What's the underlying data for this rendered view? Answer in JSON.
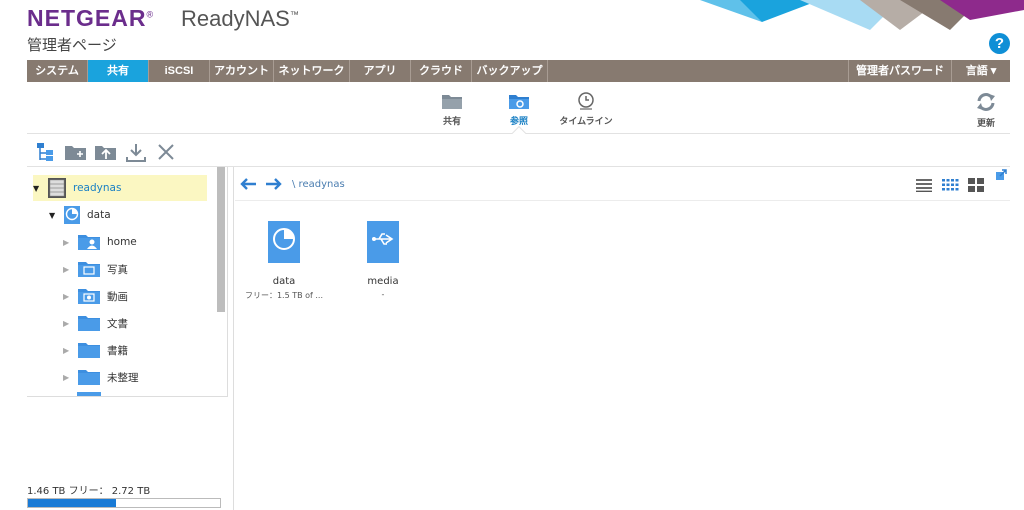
{
  "header": {
    "brand": "NETGEAR",
    "brand_mark": "®",
    "product": "ReadyNAS",
    "product_mark": "™",
    "subtitle": "管理者ページ",
    "help": "?"
  },
  "nav": {
    "tabs": [
      {
        "label": "システム",
        "active": false
      },
      {
        "label": "共有",
        "active": true
      },
      {
        "label": "iSCSI",
        "active": false
      },
      {
        "label": "アカウント",
        "active": false
      },
      {
        "label": "ネットワーク",
        "active": false
      },
      {
        "label": "アプリ",
        "active": false
      },
      {
        "label": "クラウド",
        "active": false
      },
      {
        "label": "バックアップ",
        "active": false
      }
    ],
    "admin_password": "管理者パスワード",
    "language": "言語 ▾"
  },
  "subnav": {
    "shares": "共有",
    "browse": "参照",
    "timeline": "タイムライン",
    "refresh": "更新"
  },
  "tree": {
    "root": "readynas",
    "volume": "data",
    "folders": [
      "home",
      "写真",
      "動画",
      "文書",
      "書籍",
      "未整理"
    ]
  },
  "path": "\\ readynas",
  "files": [
    {
      "name": "data",
      "sub": "フリー：1.5 TB of ..."
    },
    {
      "name": "media",
      "sub": "-"
    }
  ],
  "usage": {
    "text": "1.46 TB フリー： 2.72 TB",
    "fraction": 0.46
  },
  "colors": {
    "brand": "#6b2d8c",
    "nav": "#877a70",
    "active_tab": "#1aa3dd",
    "icon_blue": "#4a9be8",
    "usage_fill": "#1a7bd6"
  }
}
